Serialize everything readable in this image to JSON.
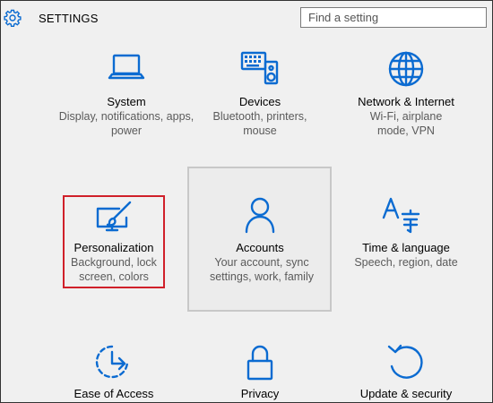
{
  "header": {
    "title": "SETTINGS",
    "search_placeholder": "Find a setting"
  },
  "tiles": [
    {
      "name": "System",
      "desc": "Display, notifications, apps, power",
      "icon": "laptop-icon"
    },
    {
      "name": "Devices",
      "desc": "Bluetooth, printers, mouse",
      "icon": "keyboard-speaker-icon"
    },
    {
      "name": "Network & Internet",
      "desc": "Wi-Fi, airplane mode, VPN",
      "icon": "globe-icon"
    },
    {
      "name": "Personalization",
      "desc": "Background, lock screen, colors",
      "icon": "monitor-brush-icon"
    },
    {
      "name": "Accounts",
      "desc": "Your account, sync settings, work, family",
      "icon": "person-icon"
    },
    {
      "name": "Time & language",
      "desc": "Speech, region, date",
      "icon": "time-language-icon"
    },
    {
      "name": "Ease of Access",
      "desc": "",
      "icon": "ease-of-access-icon"
    },
    {
      "name": "Privacy",
      "desc": "",
      "icon": "lock-icon"
    },
    {
      "name": "Update & security",
      "desc": "",
      "icon": "refresh-icon"
    }
  ],
  "colors": {
    "accent": "#0b6bd1",
    "highlight_border": "#d0202a",
    "background": "#f0f0f0"
  }
}
